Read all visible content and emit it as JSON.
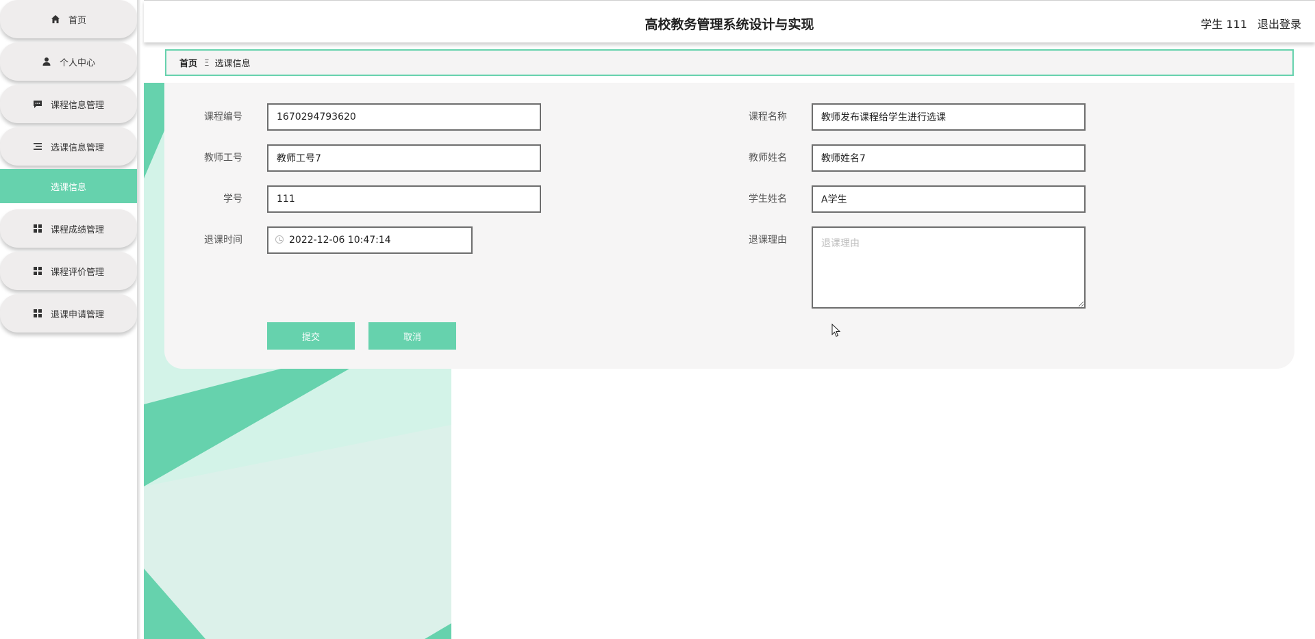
{
  "app": {
    "title": "高校教务管理系统设计与实现",
    "user_label": "学生 111",
    "logout_label": "退出登录"
  },
  "sidebar": {
    "items": [
      {
        "label": "首页",
        "icon": "home-icon"
      },
      {
        "label": "个人中心",
        "icon": "user-icon"
      },
      {
        "label": "课程信息管理",
        "icon": "message-icon"
      },
      {
        "label": "选课信息管理",
        "icon": "list-icon"
      },
      {
        "label": "课程成绩管理",
        "icon": "grid-icon"
      },
      {
        "label": "课程评价管理",
        "icon": "grid-icon"
      },
      {
        "label": "退课申请管理",
        "icon": "grid-icon"
      }
    ],
    "active_sub": "选课信息"
  },
  "breadcrumb": {
    "home": "首页",
    "separator": "Ξ",
    "current": "选课信息"
  },
  "form": {
    "course_id": {
      "label": "课程编号",
      "value": "1670294793620"
    },
    "course_name": {
      "label": "课程名称",
      "value": "教师发布课程给学生进行选课"
    },
    "teacher_id": {
      "label": "教师工号",
      "value": "教师工号7"
    },
    "teacher_name": {
      "label": "教师姓名",
      "value": "教师姓名7"
    },
    "student_id": {
      "label": "学号",
      "value": "111"
    },
    "student_name": {
      "label": "学生姓名",
      "value": "A学生"
    },
    "drop_time": {
      "label": "退课时间",
      "value": "2022-12-06 10:47:14"
    },
    "drop_reason": {
      "label": "退课理由",
      "value": "",
      "placeholder": "退课理由"
    },
    "submit_label": "提交",
    "cancel_label": "取消"
  },
  "colors": {
    "accent": "#66d2ad",
    "card_bg": "#f6f5f5"
  }
}
